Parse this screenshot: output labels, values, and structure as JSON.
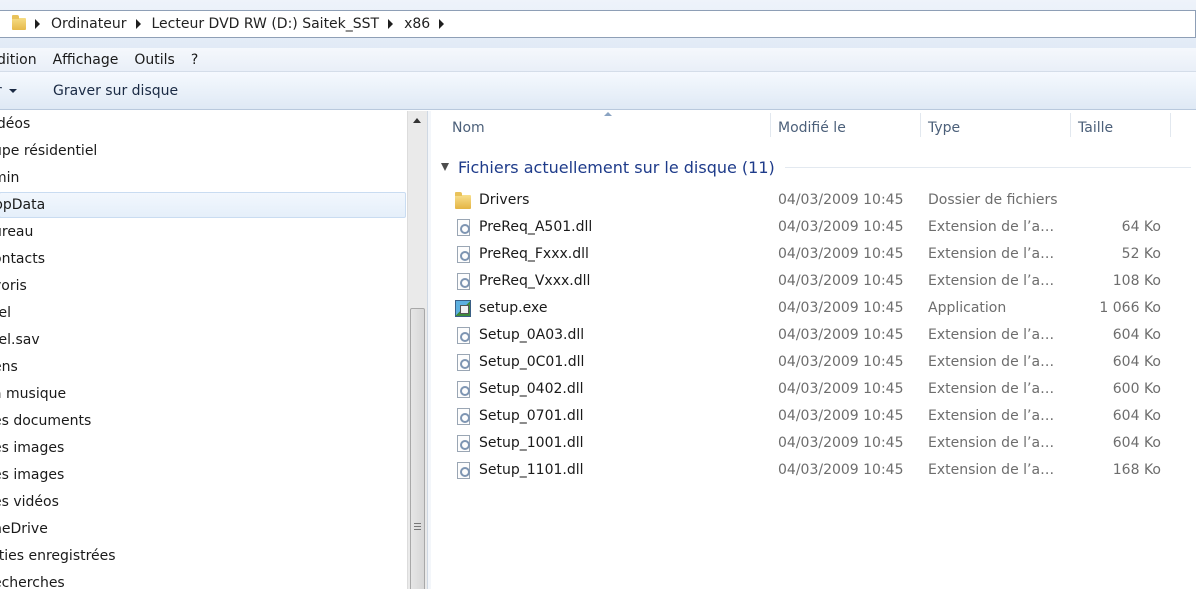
{
  "breadcrumb": [
    "Ordinateur",
    "Lecteur DVD RW (D:) Saitek_SST",
    "x86"
  ],
  "menu": [
    "dition",
    "Affichage",
    "Outils",
    "?"
  ],
  "toolbar": {
    "left_label": "r",
    "burn_label": "Graver sur disque"
  },
  "nav_items": [
    "idéos",
    "upe résidentiel",
    "min",
    "ppData",
    "ureau",
    "ontacts",
    "voris",
    "tel",
    "tel.sav",
    "ens",
    "a musique",
    "es documents",
    "es images",
    "es images",
    "es vidéos",
    "neDrive",
    "rties enregistrées",
    "echerches"
  ],
  "nav_selected_index": 3,
  "columns": {
    "name": "Nom",
    "modified": "Modifié le",
    "type": "Type",
    "size": "Taille"
  },
  "group_title": "Fichiers actuellement sur le disque (11)",
  "files": [
    {
      "name": "Drivers",
      "date": "04/03/2009 10:45",
      "type": "Dossier de fichiers",
      "size": "",
      "icon": "folder-icon"
    },
    {
      "name": "PreReq_A501.dll",
      "date": "04/03/2009 10:45",
      "type": "Extension de l’app...",
      "size": "64 Ko",
      "icon": "dll-icon"
    },
    {
      "name": "PreReq_Fxxx.dll",
      "date": "04/03/2009 10:45",
      "type": "Extension de l’app...",
      "size": "52 Ko",
      "icon": "dll-icon"
    },
    {
      "name": "PreReq_Vxxx.dll",
      "date": "04/03/2009 10:45",
      "type": "Extension de l’app...",
      "size": "108 Ko",
      "icon": "dll-icon"
    },
    {
      "name": "setup.exe",
      "date": "04/03/2009 10:45",
      "type": "Application",
      "size": "1 066 Ko",
      "icon": "exe-icon"
    },
    {
      "name": "Setup_0A03.dll",
      "date": "04/03/2009 10:45",
      "type": "Extension de l’app...",
      "size": "604 Ko",
      "icon": "dll-icon"
    },
    {
      "name": "Setup_0C01.dll",
      "date": "04/03/2009 10:45",
      "type": "Extension de l’app...",
      "size": "604 Ko",
      "icon": "dll-icon"
    },
    {
      "name": "Setup_0402.dll",
      "date": "04/03/2009 10:45",
      "type": "Extension de l’app...",
      "size": "600 Ko",
      "icon": "dll-icon"
    },
    {
      "name": "Setup_0701.dll",
      "date": "04/03/2009 10:45",
      "type": "Extension de l’app...",
      "size": "604 Ko",
      "icon": "dll-icon"
    },
    {
      "name": "Setup_1001.dll",
      "date": "04/03/2009 10:45",
      "type": "Extension de l’app...",
      "size": "604 Ko",
      "icon": "dll-icon"
    },
    {
      "name": "Setup_1101.dll",
      "date": "04/03/2009 10:45",
      "type": "Extension de l’app...",
      "size": "168 Ko",
      "icon": "dll-icon"
    }
  ]
}
